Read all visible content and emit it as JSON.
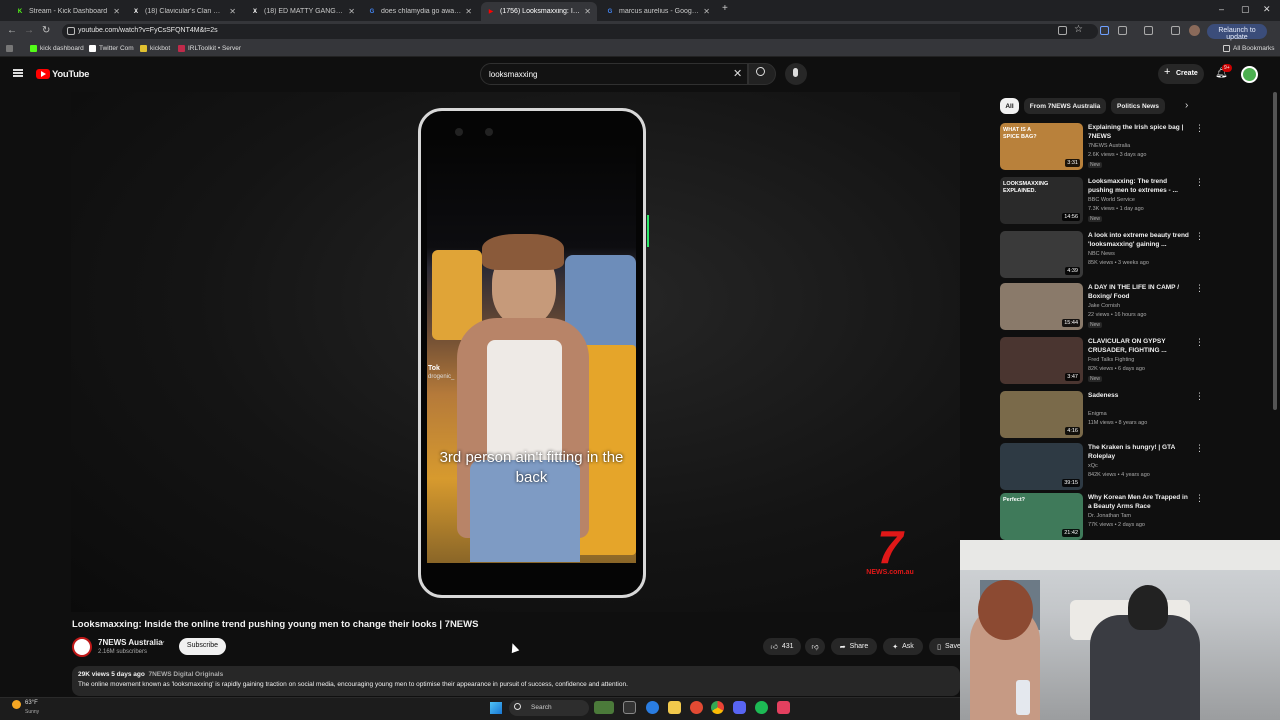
{
  "browser": {
    "tabs": [
      {
        "label": "Stream - Kick Dashboard",
        "fav": "K",
        "favcolor": "#53fc18"
      },
      {
        "label": "(18) Clavicular's Clan Commun",
        "fav": "X",
        "favcolor": "#ffffff"
      },
      {
        "label": "(18) ED MATTY GANG Commun",
        "fav": "X",
        "favcolor": "#ffffff"
      },
      {
        "label": "does chlamydia go away - Goo",
        "fav": "G",
        "favcolor": "#4285f4"
      },
      {
        "label": "(1756) Looksmaxxing: Insid",
        "fav": "▶",
        "favcolor": "#ff0000"
      },
      {
        "label": "marcus aurelius - Google Sear",
        "fav": "G",
        "favcolor": "#4285f4"
      }
    ],
    "new_tab": "+",
    "url": "youtube.com/watch?v=FyCsSFQNT4M&t=2s",
    "relaunch": "Relaunch to update",
    "bookmarks": [
      "kick dashboard",
      "Twitter Com",
      "kickbot",
      "IRLToolkit • Server"
    ],
    "all_bookmarks": "All Bookmarks"
  },
  "youtube": {
    "logo": "YouTube",
    "search_value": "looksmaxxing",
    "create": "Create",
    "notif_count": "9+"
  },
  "video": {
    "caption": "3rd person ain't fitting in the back",
    "tiktok_handle": "Tok",
    "tiktok_sub": "drogenic_",
    "brand_logo": "7",
    "brand_sub": "NEWS.com.au",
    "title": "Looksmaxxing: Inside the online trend pushing young men to change their looks | 7NEWS",
    "channel": "7NEWS Australia",
    "subscribers": "2.16M subscribers",
    "subscribe": "Subscribe",
    "likes": "431",
    "share": "Share",
    "ask": "Ask",
    "save": "Save",
    "views_date": "29K views  5 days ago",
    "tag": "7NEWS Digital Originals",
    "description": "The online movement known as 'looksmaxxing' is rapidly gaining traction on social media, encouraging young men to optimise their appearance in pursuit of success, confidence and attention."
  },
  "sidebar": {
    "chips": [
      "All",
      "From 7NEWS Australia",
      "Politics News"
    ],
    "recommendations": [
      {
        "title": "Explaining the Irish spice bag | 7NEWS",
        "channel": "7NEWS Australia",
        "meta": "2.6K views • 3 days ago",
        "new": "New",
        "duration": "3:31",
        "thumb": "#b9813b",
        "thumb_text": "WHAT IS A SPICE BAG?"
      },
      {
        "title": "Looksmaxxing: The trend pushing men to extremes - ...",
        "channel": "BBC World Service",
        "meta": "7.3K views • 1 day ago",
        "new": "New",
        "duration": "14:56",
        "thumb": "#2a2a2a",
        "thumb_text": "LOOKSMAXXING EXPLAINED."
      },
      {
        "title": "A look into extreme beauty trend 'looksmaxxing' gaining ...",
        "channel": "NBC News",
        "meta": "85K views • 3 weeks ago",
        "new": "",
        "duration": "4:39",
        "thumb": "#3a3a3a",
        "thumb_text": ""
      },
      {
        "title": "A DAY IN THE LIFE IN CAMP / Boxing/ Food",
        "channel": "Jake Cornish",
        "meta": "22 views • 16 hours ago",
        "new": "New",
        "duration": "15:44",
        "thumb": "#8a7a6a",
        "thumb_text": ""
      },
      {
        "title": "CLAVICULAR ON GYPSY CRUSADER, FIGHTING ...",
        "channel": "Fred Talks Fighting",
        "meta": "82K views • 6 days ago",
        "new": "New",
        "duration": "3:47",
        "thumb": "#4a3530",
        "thumb_text": ""
      },
      {
        "title": "Sadeness",
        "channel": "Enigma",
        "meta": "11M views • 8 years ago",
        "new": "",
        "duration": "4:16",
        "thumb": "#7a6a4a",
        "thumb_text": ""
      },
      {
        "title": "The Kraken is hungry! | GTA Roleplay",
        "channel": "xQc",
        "meta": "842K views • 4 years ago",
        "new": "",
        "duration": "39:15",
        "thumb": "#2e3a44",
        "thumb_text": ""
      },
      {
        "title": "Why Korean Men Are Trapped in a Beauty Arms Race",
        "channel": "Dr. Jonathan Tam",
        "meta": "77K views • 2 days ago",
        "new": "",
        "duration": "21:42",
        "thumb": "#3f7a5a",
        "thumb_text": "Perfect?"
      }
    ]
  },
  "taskbar": {
    "weather_temp": "63°F",
    "weather_desc": "Sunny",
    "search": "Search"
  }
}
